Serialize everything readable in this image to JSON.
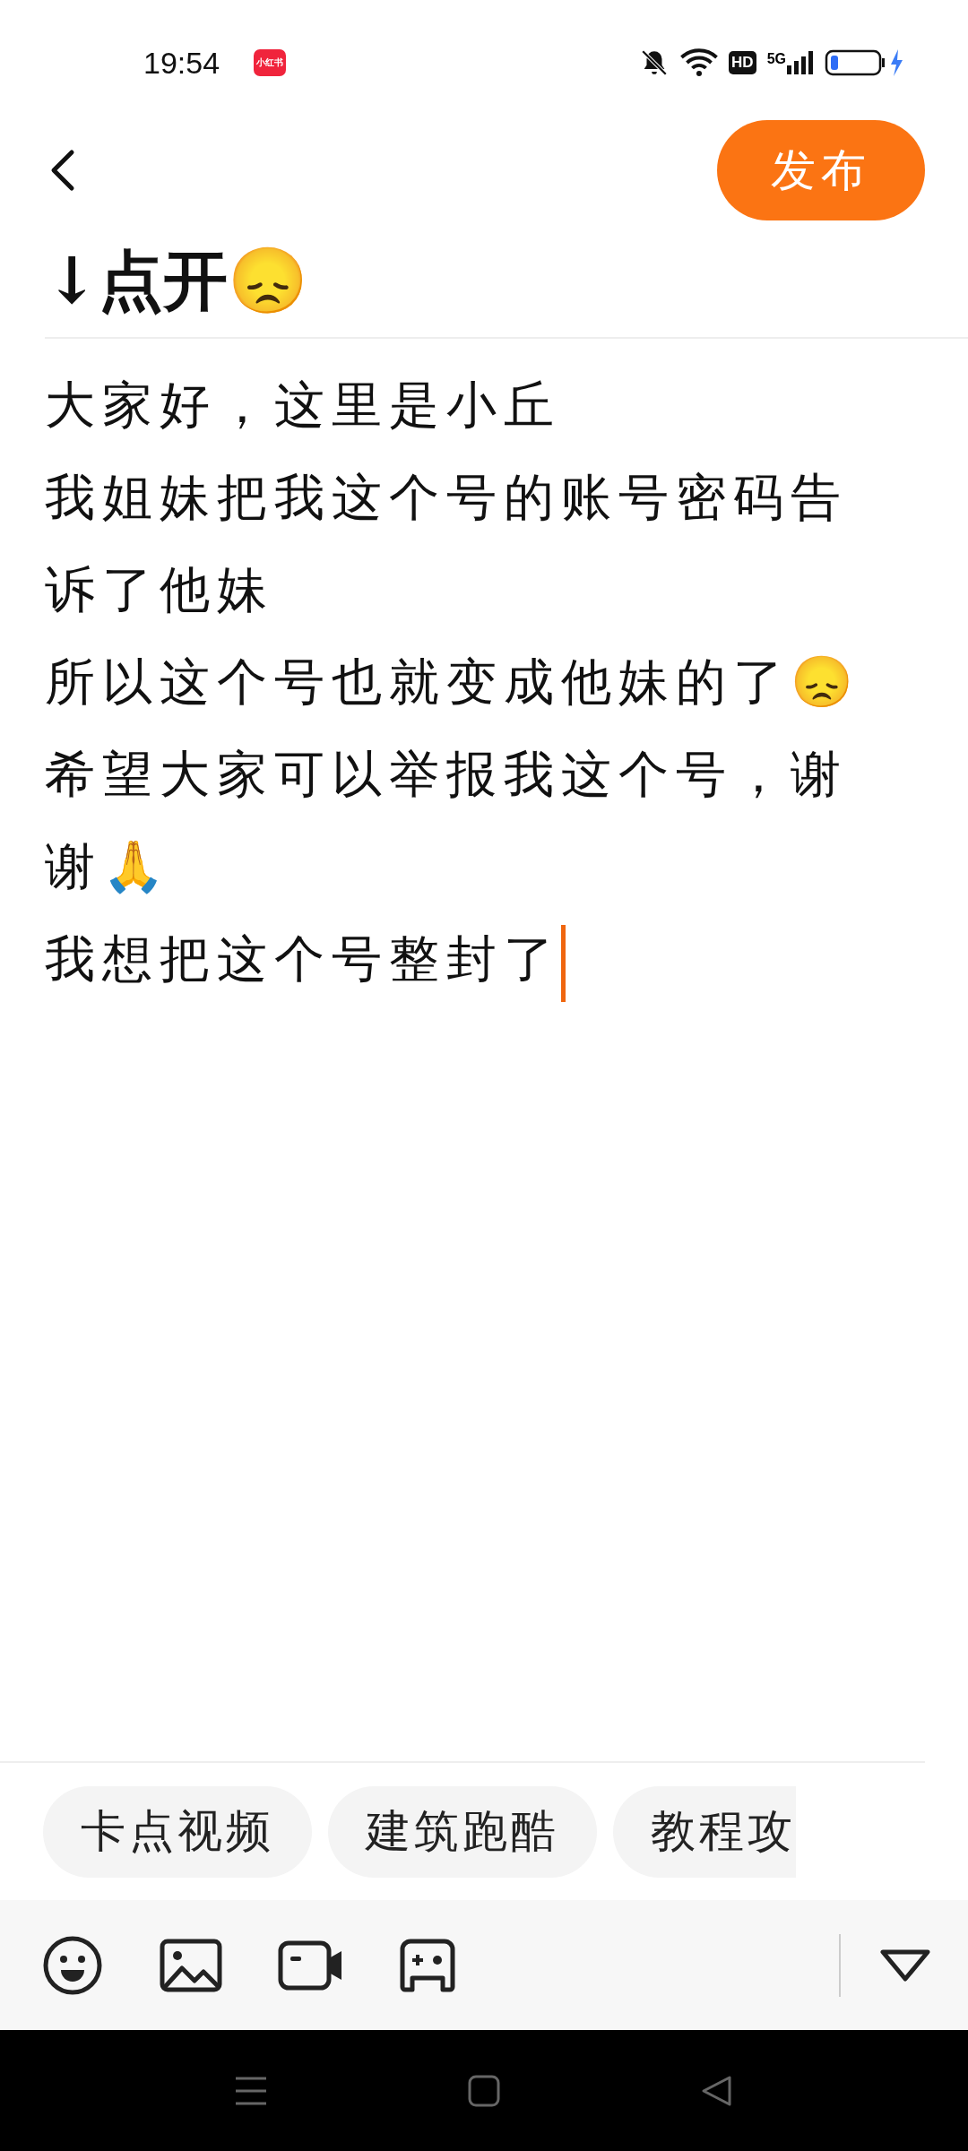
{
  "status_bar": {
    "time": "19:54",
    "app_icon": "小红书",
    "network": "5G",
    "hd": "HD"
  },
  "header": {
    "publish_button": "发布"
  },
  "title": "↓点开😞",
  "body": [
    "大家好，这里是小丘",
    "我姐妹把我这个号的账号密码告诉了他妹",
    "所以这个号也就变成他妹的了😞",
    "希望大家可以举报我这个号，谢谢🙏",
    "我想把这个号整封了"
  ],
  "topic_chips": [
    "卡点视频",
    "建筑跑酷",
    "教程攻"
  ]
}
